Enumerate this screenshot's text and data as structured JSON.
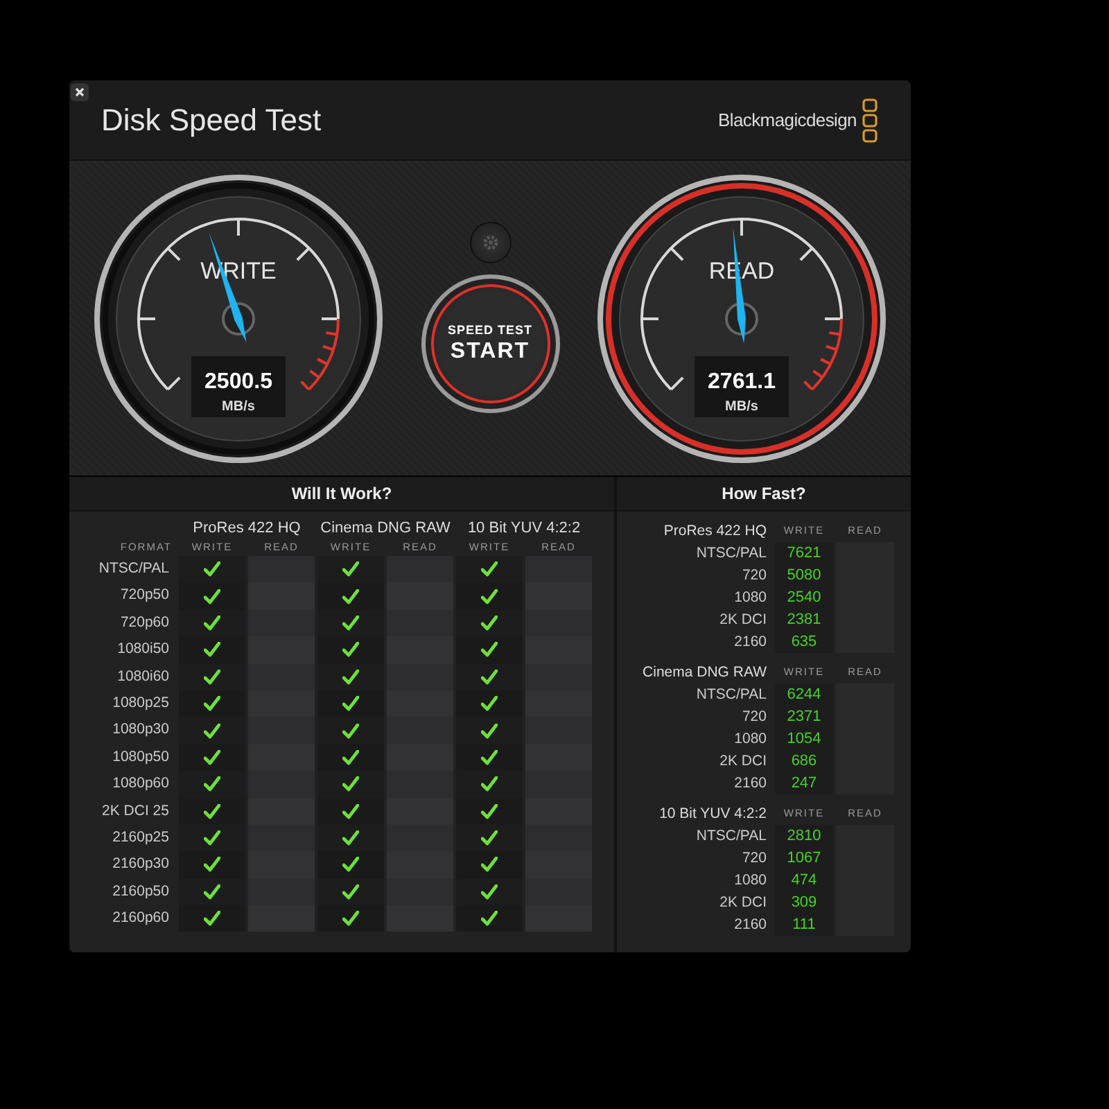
{
  "window": {
    "title": "Disk Speed Test",
    "brand": "Blackmagicdesign"
  },
  "gauges": [
    {
      "label": "WRITE",
      "value": "2500.5",
      "unit": "MB/s",
      "level": 0.43,
      "lit": false
    },
    {
      "label": "READ",
      "value": "2761.1",
      "unit": "MB/s",
      "level": 0.48,
      "lit": true
    }
  ],
  "start_button": {
    "caption": "SPEED TEST",
    "label": "START"
  },
  "will_it_work": {
    "title": "Will It Work?",
    "format_header": "FORMAT",
    "codecs": [
      {
        "name": "ProRes 422 HQ",
        "write_header": "WRITE",
        "read_header": "READ"
      },
      {
        "name": "Cinema DNG RAW",
        "write_header": "WRITE",
        "read_header": "READ"
      },
      {
        "name": "10 Bit YUV 4:2:2",
        "write_header": "WRITE",
        "read_header": "READ"
      }
    ],
    "rows": [
      {
        "format": "NTSC/PAL",
        "results": [
          {
            "write": true,
            "read": false
          },
          {
            "write": true,
            "read": false
          },
          {
            "write": true,
            "read": false
          }
        ]
      },
      {
        "format": "720p50",
        "results": [
          {
            "write": true,
            "read": false
          },
          {
            "write": true,
            "read": false
          },
          {
            "write": true,
            "read": false
          }
        ]
      },
      {
        "format": "720p60",
        "results": [
          {
            "write": true,
            "read": false
          },
          {
            "write": true,
            "read": false
          },
          {
            "write": true,
            "read": false
          }
        ]
      },
      {
        "format": "1080i50",
        "results": [
          {
            "write": true,
            "read": false
          },
          {
            "write": true,
            "read": false
          },
          {
            "write": true,
            "read": false
          }
        ]
      },
      {
        "format": "1080i60",
        "results": [
          {
            "write": true,
            "read": false
          },
          {
            "write": true,
            "read": false
          },
          {
            "write": true,
            "read": false
          }
        ]
      },
      {
        "format": "1080p25",
        "results": [
          {
            "write": true,
            "read": false
          },
          {
            "write": true,
            "read": false
          },
          {
            "write": true,
            "read": false
          }
        ]
      },
      {
        "format": "1080p30",
        "results": [
          {
            "write": true,
            "read": false
          },
          {
            "write": true,
            "read": false
          },
          {
            "write": true,
            "read": false
          }
        ]
      },
      {
        "format": "1080p50",
        "results": [
          {
            "write": true,
            "read": false
          },
          {
            "write": true,
            "read": false
          },
          {
            "write": true,
            "read": false
          }
        ]
      },
      {
        "format": "1080p60",
        "results": [
          {
            "write": true,
            "read": false
          },
          {
            "write": true,
            "read": false
          },
          {
            "write": true,
            "read": false
          }
        ]
      },
      {
        "format": "2K DCI 25",
        "results": [
          {
            "write": true,
            "read": false
          },
          {
            "write": true,
            "read": false
          },
          {
            "write": true,
            "read": false
          }
        ]
      },
      {
        "format": "2160p25",
        "results": [
          {
            "write": true,
            "read": false
          },
          {
            "write": true,
            "read": false
          },
          {
            "write": true,
            "read": false
          }
        ]
      },
      {
        "format": "2160p30",
        "results": [
          {
            "write": true,
            "read": false
          },
          {
            "write": true,
            "read": false
          },
          {
            "write": true,
            "read": false
          }
        ]
      },
      {
        "format": "2160p50",
        "results": [
          {
            "write": true,
            "read": false
          },
          {
            "write": true,
            "read": false
          },
          {
            "write": true,
            "read": false
          }
        ]
      },
      {
        "format": "2160p60",
        "results": [
          {
            "write": true,
            "read": false
          },
          {
            "write": true,
            "read": false
          },
          {
            "write": true,
            "read": false
          }
        ]
      }
    ]
  },
  "how_fast": {
    "title": "How Fast?",
    "sections": [
      {
        "codec": "ProRes 422 HQ",
        "write_header": "WRITE",
        "read_header": "READ",
        "rows": [
          {
            "format": "NTSC/PAL",
            "write": "7621"
          },
          {
            "format": "720",
            "write": "5080"
          },
          {
            "format": "1080",
            "write": "2540"
          },
          {
            "format": "2K DCI",
            "write": "2381"
          },
          {
            "format": "2160",
            "write": "635"
          }
        ]
      },
      {
        "codec": "Cinema DNG RAW",
        "write_header": "WRITE",
        "read_header": "READ",
        "rows": [
          {
            "format": "NTSC/PAL",
            "write": "6244"
          },
          {
            "format": "720",
            "write": "2371"
          },
          {
            "format": "1080",
            "write": "1054"
          },
          {
            "format": "2K DCI",
            "write": "686"
          },
          {
            "format": "2160",
            "write": "247"
          }
        ]
      },
      {
        "codec": "10 Bit YUV 4:2:2",
        "write_header": "WRITE",
        "read_header": "READ",
        "rows": [
          {
            "format": "NTSC/PAL",
            "write": "2810"
          },
          {
            "format": "720",
            "write": "1067"
          },
          {
            "format": "1080",
            "write": "474"
          },
          {
            "format": "2K DCI",
            "write": "309"
          },
          {
            "format": "2160",
            "write": "111"
          }
        ]
      }
    ]
  }
}
